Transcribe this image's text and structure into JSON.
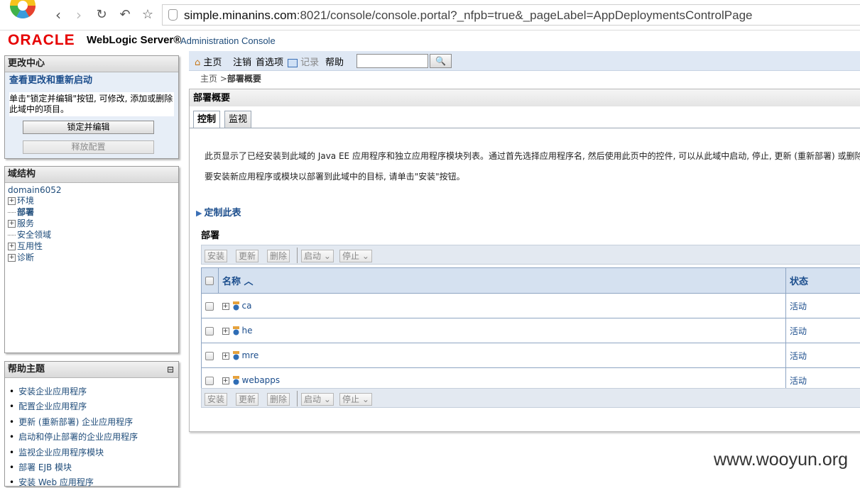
{
  "browser": {
    "url_host": "simple.minanins.com",
    "url_rest": ":8021/console/console.portal?_nfpb=true&_pageLabel=AppDeploymentsControlPage"
  },
  "header": {
    "oracle": "ORACLE",
    "product": "WebLogic Server®",
    "subtitle": "Administration Console"
  },
  "change_center": {
    "title": "更改中心",
    "subtitle": "查看更改和重新启动",
    "description": "单击\"锁定并编辑\"按钮, 可修改, 添加或删除此域中的项目。",
    "lock_button": "锁定并编辑",
    "release_button": "释放配置"
  },
  "domain_structure": {
    "title": "域结构",
    "domain": "domain6052",
    "items": [
      "环境",
      "部署",
      "服务",
      "安全领域",
      "互用性",
      "诊断"
    ]
  },
  "help": {
    "title": "帮助主题",
    "collapse": "⊟",
    "items": [
      "安装企业应用程序",
      "配置企业应用程序",
      "更新 (重新部署) 企业应用程序",
      "启动和停止部署的企业应用程序",
      "监视企业应用程序模块",
      "部署 EJB 模块",
      "安装 Web 应用程序"
    ]
  },
  "toolbar": {
    "home": "主页",
    "logout": "注销",
    "preferences": "首选项",
    "record": "记录",
    "help": "帮助",
    "search_icon": "🔍"
  },
  "breadcrumb": {
    "home": "主页",
    "sep": " >",
    "current": "部署概要"
  },
  "main": {
    "title": "部署概要",
    "tabs": [
      "控制",
      "监视"
    ],
    "para1": "此页显示了已经安装到此域的 Java EE 应用程序和独立应用程序模块列表。通过首先选择应用程序名, 然后使用此页中的控件, 可以从此域中启动, 停止, 更新 (重新部署) 或删除",
    "para2": "要安装新应用程序或模块以部署到此域中的目标, 请单击\"安装\"按钮。",
    "customize": "定制此表",
    "deploy_label": "部署",
    "buttons": {
      "install": "安装",
      "update": "更新",
      "delete": "删除",
      "start": "启动",
      "stop": "停止"
    },
    "table": {
      "col_name": "名称",
      "col_state": "状态",
      "rows": [
        {
          "name": "ca",
          "state": "活动"
        },
        {
          "name": "he",
          "state": "活动"
        },
        {
          "name": "mre",
          "state": "活动"
        },
        {
          "name": "webapps",
          "state": "活动"
        }
      ]
    }
  },
  "watermark": "www.wooyun.org"
}
